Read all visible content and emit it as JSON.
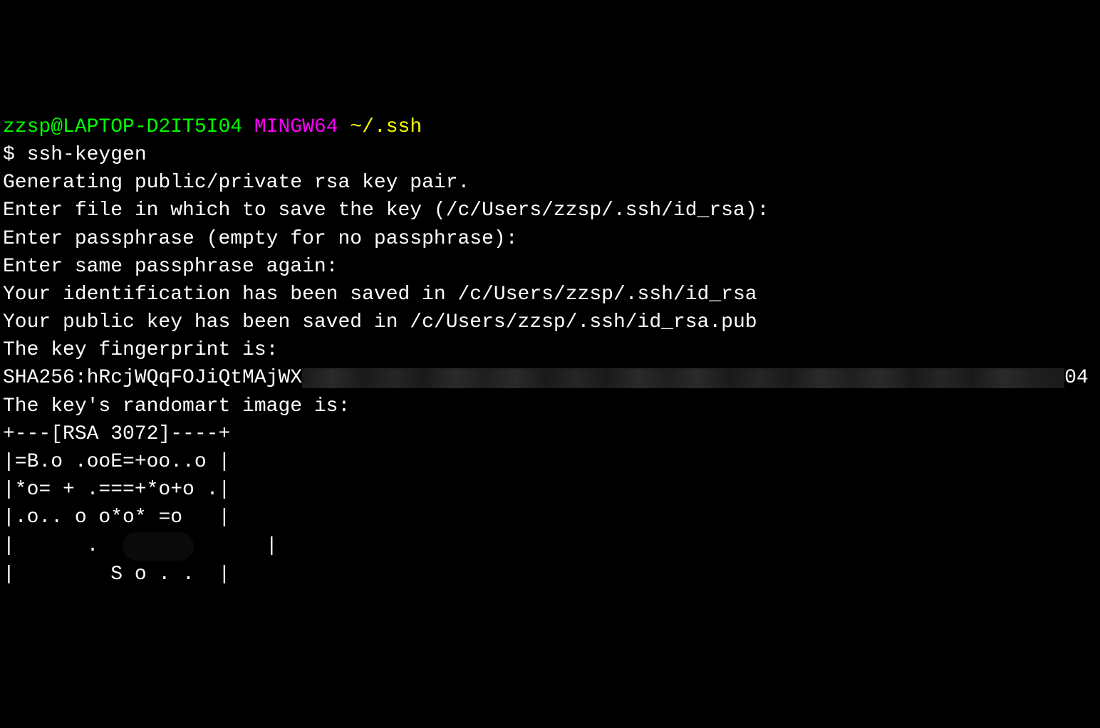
{
  "prompt": {
    "user_host": "zzsp@LAPTOP-D2IT5I04",
    "env": "MINGW64",
    "path": "~/.ssh",
    "symbol": "$ ",
    "command": "ssh-keygen"
  },
  "output": {
    "line1": "Generating public/private rsa key pair.",
    "line2": "Enter file in which to save the key (/c/Users/zzsp/.ssh/id_rsa):",
    "line3": "Enter passphrase (empty for no passphrase):",
    "line4": "Enter same passphrase again:",
    "line5": "Your identification has been saved in /c/Users/zzsp/.ssh/id_rsa",
    "line6": "Your public key has been saved in /c/Users/zzsp/.ssh/id_rsa.pub",
    "line7": "The key fingerprint is:",
    "fingerprint_prefix": "SHA256:hRcjWQqFOJiQtMAjWX",
    "fingerprint_suffix": "04",
    "line9": "The key's randomart image is:",
    "randomart": {
      "r0": "+---[RSA 3072]----+",
      "r1": "|=B.o .ooE=+oo..o |",
      "r2": "|*o= + .===+*o+o .|",
      "r3_pre": "|.o.. o o*o* ",
      "r3_mid": "=o",
      "r3_post": "   |",
      "r4_pre": "|      .  ",
      "r4_post": "      |",
      "r5": "|        S o . .  |"
    }
  }
}
